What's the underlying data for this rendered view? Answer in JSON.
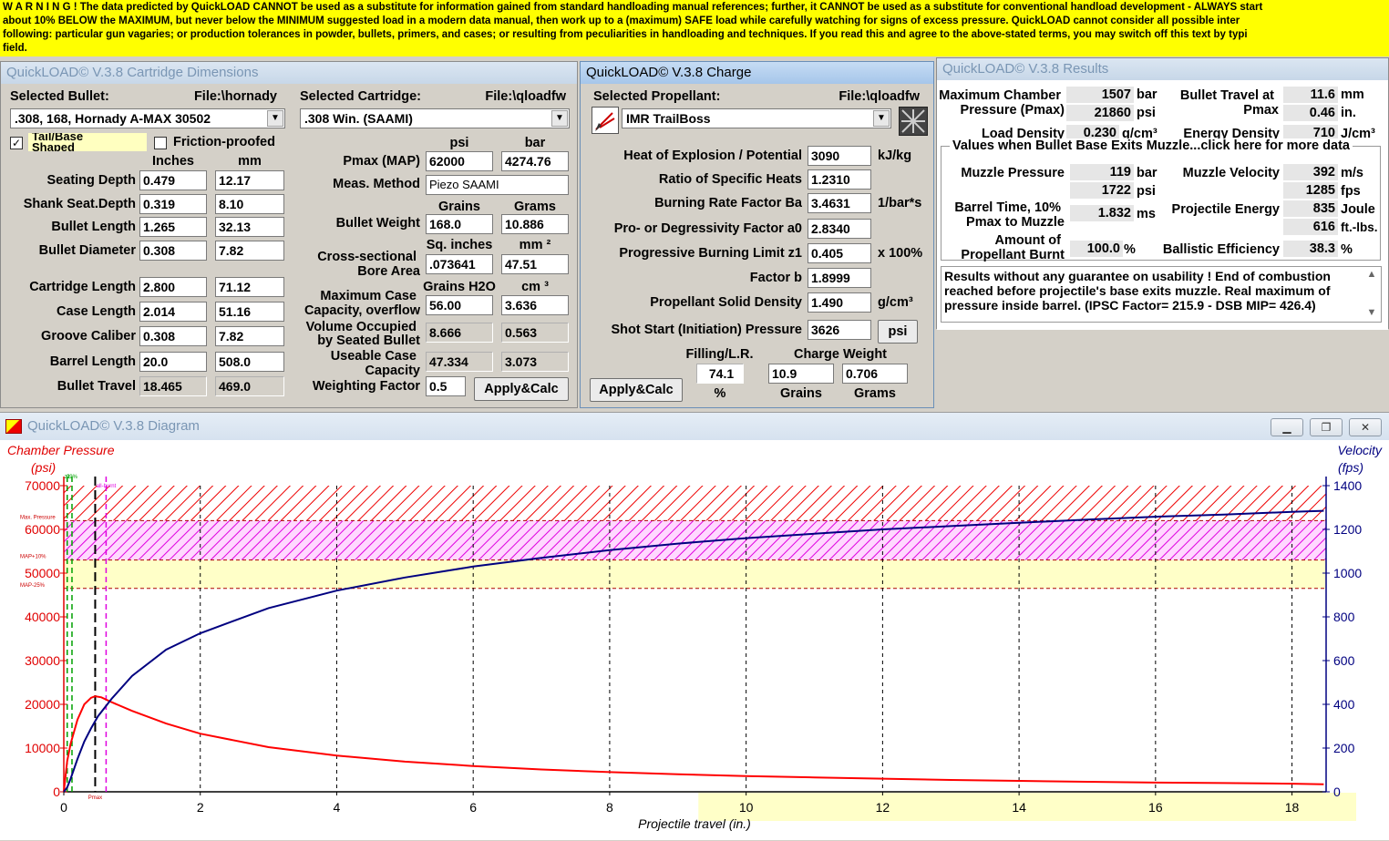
{
  "warning": {
    "lines": [
      "W A R N I N G ! The data predicted by QuickLOAD CANNOT be used as a substitute for information gained from standard handloading manual references; further, it CANNOT be used as a substitute for conventional handload development - ALWAYS start",
      "about 10% BELOW the MAXIMUM, but never below the MINIMUM suggested load in a modern data manual, then work up to a (maximum) SAFE load while carefully watching for signs of excess pressure. QuickLOAD cannot consider all possible inter",
      "following: particular gun vagaries; or production tolerances in powder, bullets, primers, and cases; or resulting from peculiarities in handloading and techniques. If you read this and agree to the above-stated terms, you may switch off this text by typi",
      "field."
    ]
  },
  "dimensions": {
    "title": "QuickLOAD© V.3.8 Cartridge Dimensions",
    "selected_bullet_label": "Selected Bullet:",
    "bullet_file": "File:\\hornady",
    "bullet_value": ".308, 168, Hornady A-MAX 30502",
    "selected_cartridge_label": "Selected Cartridge:",
    "cartridge_file": "File:\\qloadfw",
    "cartridge_value": ".308 Win. (SAAMI)",
    "tail_label_1": "Tail/Base",
    "tail_label_2": "Shaped",
    "friction_label": "Friction-proofed",
    "tail_checked": "✓",
    "col_inches": "Inches",
    "col_mm": "mm",
    "rows": [
      {
        "label": "Seating Depth",
        "in": "0.479",
        "mm": "12.17"
      },
      {
        "label": "Shank Seat.Depth",
        "in": "0.319",
        "mm": "8.10"
      },
      {
        "label": "Bullet Length",
        "in": "1.265",
        "mm": "32.13"
      },
      {
        "label": "Bullet Diameter",
        "in": "0.308",
        "mm": "7.82"
      },
      {
        "label": "Cartridge Length",
        "in": "2.800",
        "mm": "71.12"
      },
      {
        "label": "Case Length",
        "in": "2.014",
        "mm": "51.16"
      },
      {
        "label": "Groove Caliber",
        "in": "0.308",
        "mm": "7.82"
      },
      {
        "label": "Barrel Length",
        "in": "20.0",
        "mm": "508.0"
      },
      {
        "label": "Bullet Travel",
        "in": "18.465",
        "mm": "469.0"
      }
    ],
    "col_psi": "psi",
    "col_bar": "bar",
    "pmax_label": "Pmax (MAP)",
    "pmax_psi": "62000",
    "pmax_bar": "4274.76",
    "meas_label": "Meas. Method",
    "meas_value": "Piezo SAAMI",
    "col_grains": "Grains",
    "col_grams": "Grams",
    "bullet_weight_label": "Bullet Weight",
    "bw_grains": "168.0",
    "bw_grams": "10.886",
    "col_sqin": "Sq. inches",
    "col_mm2": "mm ²",
    "cross_label_1": "Cross-sectional",
    "cross_label_2": "Bore Area",
    "cross_sqin": ".073641",
    "cross_mm2": "47.51",
    "col_h2o": "Grains H2O",
    "col_cm3": "cm ³",
    "maxcase_label_1": "Maximum Case",
    "maxcase_label_2": "Capacity, overflow",
    "maxcase_gr": "56.00",
    "maxcase_cm": "3.636",
    "volocc_label_1": "Volume Occupied",
    "volocc_label_2": "by Seated Bullet",
    "volocc_gr": "8.666",
    "volocc_cm": "0.563",
    "useable_label_1": "Useable Case",
    "useable_label_2": "Capacity",
    "useable_gr": "47.334",
    "useable_cm": "3.073",
    "weighting_label": "Weighting Factor",
    "weighting_value": "0.5",
    "apply_label": "Apply&Calc"
  },
  "charge": {
    "title": "QuickLOAD© V.3.8 Charge",
    "selected_propellant_label": "Selected Propellant:",
    "propellant_file": "File:\\qloadfw",
    "propellant_value": "IMR TrailBoss",
    "rows": [
      {
        "label": "Heat of Explosion / Potential",
        "value": "3090",
        "unit": "kJ/kg"
      },
      {
        "label": "Ratio of Specific Heats",
        "value": "1.2310",
        "unit": ""
      },
      {
        "label": "Burning Rate Factor  Ba",
        "value": "3.4631",
        "unit": "1/bar*s"
      },
      {
        "label": "Pro- or Degressivity Factor  a0",
        "value": "2.8340",
        "unit": ""
      },
      {
        "label": "Progressive Burning Limit z1",
        "value": "0.405",
        "unit": "x 100%"
      },
      {
        "label": "Factor  b",
        "value": "1.8999",
        "unit": ""
      },
      {
        "label": "Propellant Solid Density",
        "value": "1.490",
        "unit": "g/cm³"
      }
    ],
    "shot_start_label": "Shot Start (Initiation) Pressure",
    "shot_start_value": "3626",
    "psi_button": "psi",
    "filling_label": "Filling/L.R.",
    "filling_value": "74.1",
    "filling_unit": "%",
    "charge_weight_label": "Charge Weight",
    "cw_grains": "10.9",
    "cw_grams": "0.706",
    "cw_grains_label": "Grains",
    "cw_grams_label": "Grams",
    "apply_label": "Apply&Calc"
  },
  "results": {
    "title": "QuickLOAD© V.3.8 Results",
    "max_pressure_label_1": "Maximum Chamber",
    "max_pressure_label_2": "Pressure (Pmax)",
    "pmax_bar": "1507",
    "unit_bar": "bar",
    "pmax_psi": "21860",
    "unit_psi": "psi",
    "bullet_travel_label_1": "Bullet Travel at",
    "bullet_travel_label_2": "Pmax",
    "travel_mm": "11.6",
    "unit_mm": "mm",
    "travel_in": "0.46",
    "unit_in": "in.",
    "load_density_label": "Load Density",
    "load_density_value": "0.230",
    "load_density_unit": "g/cm³",
    "energy_density_label": "Energy Density",
    "energy_density_value": "710",
    "energy_density_unit": "J/cm³",
    "muzzle_header": "Values when Bullet Base Exits Muzzle...click here for more data",
    "muzzle_pressure_label": "Muzzle Pressure",
    "mp_bar": "119",
    "mp_psi": "1722",
    "muzzle_velocity_label": "Muzzle Velocity",
    "mv_ms": "392",
    "unit_ms": "m/s",
    "mv_fps": "1285",
    "unit_fps": "fps",
    "barrel_time_label_1": "Barrel Time, 10%",
    "barrel_time_label_2": "Pmax to Muzzle",
    "barrel_time_value": "1.832",
    "unit_ms2": "ms",
    "proj_energy_label": "Projectile Energy",
    "pe_joule": "835",
    "unit_joule": "Joule",
    "pe_ftlbs": "616",
    "unit_ftlbs": "ft.-lbs.",
    "amount_label_1": "Amount of",
    "amount_label_2": "Propellant Burnt",
    "amount_value": "100.0",
    "unit_pct": "%",
    "ballistic_label": "Ballistic Efficiency",
    "ballistic_value": "38.3",
    "message": "Results without any guarantee on usability !  End of combustion reached before projectile's base exits muzzle.  Real maximum of pressure inside barrel.  (IPSC Factor= 215.9 - DSB MIP= 426.4)"
  },
  "diagram": {
    "title": "QuickLOAD© V.3.8 Diagram",
    "left_title": "Chamber Pressure",
    "left_unit": "(psi)",
    "right_title": "Velocity",
    "right_unit": "(fps)",
    "x_title": "Projectile travel (in.)",
    "marker_z1": "z1",
    "marker_99": "99%",
    "marker_allburnt": "all-burnt",
    "marker_pmax": "Pmax",
    "band_max_label": "Max. Pressure",
    "band_map10_label": "MAP+10%",
    "band_map25_label": "MAP-25%"
  },
  "chart_data": {
    "type": "line",
    "xlabel": "Projectile travel (in.)",
    "ylabel": "Chamber Pressure (psi)",
    "y2label": "Velocity (fps)",
    "xlim": [
      0,
      18.5
    ],
    "ylim": [
      0,
      70000
    ],
    "y2lim": [
      0,
      1400
    ],
    "xticks": [
      "0",
      "2",
      "4",
      "6",
      "8",
      "10",
      "12",
      "14",
      "16",
      "18"
    ],
    "yticks": [
      "0",
      "10000",
      "20000",
      "30000",
      "40000",
      "50000",
      "60000",
      "70000"
    ],
    "y2ticks": [
      "0",
      "200",
      "400",
      "600",
      "800",
      "1000",
      "1200",
      "1400"
    ],
    "series": [
      {
        "name": "Chamber Pressure",
        "axis": "left",
        "color": "#ff0000",
        "x": [
          0,
          0.05,
          0.1,
          0.2,
          0.3,
          0.4,
          0.46,
          0.55,
          0.7,
          1,
          1.5,
          2,
          3,
          4,
          5,
          6,
          7,
          8,
          9,
          10,
          11,
          12,
          13,
          14,
          15,
          16,
          17,
          18,
          18.465
        ],
        "y": [
          0,
          7000,
          11000,
          16500,
          20000,
          21500,
          21860,
          21600,
          20500,
          18500,
          15600,
          13300,
          10200,
          8300,
          6900,
          5900,
          5100,
          4500,
          4000,
          3600,
          3300,
          3000,
          2700,
          2500,
          2300,
          2100,
          2000,
          1850,
          1722
        ]
      },
      {
        "name": "Velocity",
        "axis": "right",
        "color": "#000080",
        "x": [
          0,
          0.05,
          0.1,
          0.2,
          0.3,
          0.4,
          0.5,
          0.7,
          1,
          1.5,
          2,
          3,
          4,
          5,
          6,
          7,
          8,
          9,
          10,
          11,
          12,
          13,
          14,
          15,
          16,
          17,
          18,
          18.465
        ],
        "y": [
          0,
          20,
          60,
          150,
          230,
          290,
          345,
          425,
          530,
          650,
          725,
          840,
          920,
          980,
          1030,
          1070,
          1105,
          1135,
          1160,
          1180,
          1200,
          1215,
          1230,
          1245,
          1258,
          1268,
          1280,
          1285
        ]
      }
    ],
    "bands": [
      {
        "name": "Max. Pressure",
        "from": 62000,
        "to": 70000,
        "pattern": "red-hatch"
      },
      {
        "name": "MAP+10%",
        "from": 53000,
        "to": 62000,
        "pattern": "magenta-hatch"
      },
      {
        "name": "MAP-25%",
        "from": 46500,
        "to": 53000,
        "pattern": "yellow"
      }
    ],
    "markers": [
      {
        "name": "z1",
        "x": 0.05
      },
      {
        "name": "99%",
        "x": 0.12
      },
      {
        "name": "Pmax",
        "x": 0.46
      },
      {
        "name": "all-burnt",
        "x": 0.62
      }
    ],
    "grid": true
  },
  "colors": {
    "warning_bg": "#ffff00",
    "pressure": "#ff0000",
    "velocity": "#000080"
  }
}
